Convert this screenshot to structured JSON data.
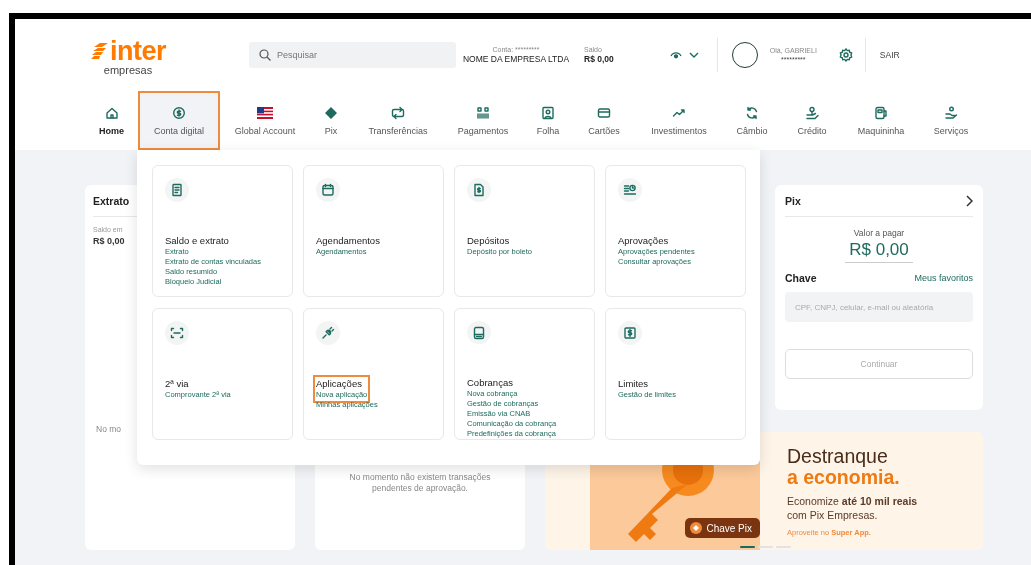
{
  "header": {
    "logo": {
      "brand": "inter",
      "subtitle": "empresas"
    },
    "search": {
      "placeholder": "Pesquisar"
    },
    "account": {
      "label": "Conta: *********",
      "name": "NOME DA EMPRESA LTDA"
    },
    "balance": {
      "label": "Saldo",
      "value": "R$ 0,00"
    },
    "user": {
      "greeting": "Olá, GABRIELI",
      "masked": "*********"
    },
    "logout": "SAIR"
  },
  "nav": [
    {
      "label": "Home",
      "selected": true,
      "expanded": false,
      "annotated": false
    },
    {
      "label": "Conta digital",
      "selected": false,
      "expanded": true,
      "annotated": true
    },
    {
      "label": "Global Account",
      "selected": false,
      "expanded": false,
      "annotated": false
    },
    {
      "label": "Pix",
      "selected": false,
      "expanded": false,
      "annotated": false
    },
    {
      "label": "Transferências",
      "selected": false,
      "expanded": false,
      "annotated": false
    },
    {
      "label": "Pagamentos",
      "selected": false,
      "expanded": false,
      "annotated": false
    },
    {
      "label": "Folha",
      "selected": false,
      "expanded": false,
      "annotated": false
    },
    {
      "label": "Cartões",
      "selected": false,
      "expanded": false,
      "annotated": false
    },
    {
      "label": "Investimentos",
      "selected": false,
      "expanded": false,
      "annotated": false
    },
    {
      "label": "Câmbio",
      "selected": false,
      "expanded": false,
      "annotated": false
    },
    {
      "label": "Crédito",
      "selected": false,
      "expanded": false,
      "annotated": false
    },
    {
      "label": "Maquininha",
      "selected": false,
      "expanded": false,
      "annotated": false
    },
    {
      "label": "Serviços",
      "selected": false,
      "expanded": false,
      "annotated": false
    }
  ],
  "menu": {
    "cards": [
      {
        "title": "Saldo e extrato",
        "links": [
          "Extrato",
          "Extrato de contas vinculadas",
          "Saldo resumido",
          "Bloqueio Judicial"
        ],
        "annotated": false
      },
      {
        "title": "Agendamentos",
        "links": [
          "Agendamentos"
        ],
        "annotated": false
      },
      {
        "title": "Depósitos",
        "links": [
          "Depósito por boleto"
        ],
        "annotated": false
      },
      {
        "title": "Aprovações",
        "links": [
          "Aprovações pendentes",
          "Consultar aprovações"
        ],
        "annotated": false
      },
      {
        "title": "2ª via",
        "links": [
          "Comprovante 2ª via"
        ],
        "annotated": false
      },
      {
        "title": "Aplicações",
        "links": [
          "Nova aplicação",
          "Minhas aplicações"
        ],
        "annotated": true
      },
      {
        "title": "Cobranças",
        "links": [
          "Nova cobrança",
          "Gestão de cobranças",
          "Emissão via CNAB",
          "Comunicação da cobrança",
          "Predefinições da cobrança"
        ],
        "annotated": false
      },
      {
        "title": "Limites",
        "links": [
          "Gestão de limites"
        ],
        "annotated": false
      }
    ]
  },
  "extrato": {
    "title": "Extrato",
    "balance_label": "Saldo em",
    "balance": "R$ 0,00",
    "empty_message": "No mo"
  },
  "approvals": {
    "empty_message": "No momento não existem transações pendentes de aprovação."
  },
  "pix": {
    "title": "Pix",
    "amount_label": "Valor a pagar",
    "amount": "R$ 0,00",
    "key_label": "Chave",
    "favorites": "Meus favoritos",
    "key_field": {
      "placeholder": "CPF, CNPJ, celular, e-mail ou aleatória"
    },
    "button": {
      "label": "Continuar",
      "disabled": true
    }
  },
  "banner": {
    "badge": "Chave Pix",
    "headline": "Destranque",
    "highlight": "a economia.",
    "text": "Economize **até 10 mil reais** com Pix Empresas.",
    "cta": "Aproveite no **Super App.**",
    "dots": [
      {
        "selected": true
      },
      {
        "selected": false
      },
      {
        "selected": false
      }
    ]
  }
}
